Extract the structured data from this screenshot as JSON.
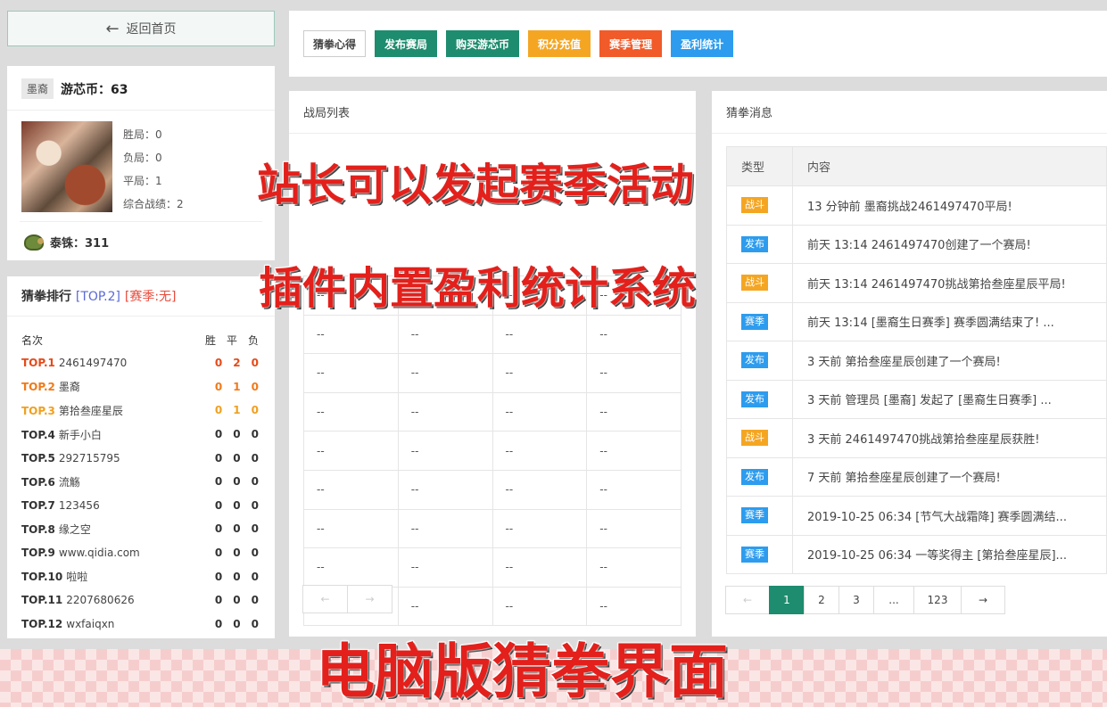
{
  "back_button": {
    "label": "返回首页"
  },
  "user": {
    "tag": "墨裔",
    "coin_label": "游芯币：63",
    "stats": [
      "胜局：0",
      "负局：0",
      "平局：1",
      "综合战绩：2"
    ],
    "pearl_label": "泰铢：311"
  },
  "ranking": {
    "title": "猜拳排行",
    "top_tag": "[TOP.2]",
    "season_tag": "[赛季:无]",
    "col_name": "名次",
    "col_win": "胜",
    "col_draw": "平",
    "col_lose": "负",
    "rows": [
      {
        "rank": "TOP.1",
        "name": "2461497470",
        "w": "0",
        "d": "2",
        "l": "0"
      },
      {
        "rank": "TOP.2",
        "name": "墨裔",
        "w": "0",
        "d": "1",
        "l": "0"
      },
      {
        "rank": "TOP.3",
        "name": "第拾叁座星辰",
        "w": "0",
        "d": "1",
        "l": "0"
      },
      {
        "rank": "TOP.4",
        "name": "新手小白",
        "w": "0",
        "d": "0",
        "l": "0"
      },
      {
        "rank": "TOP.5",
        "name": "292715795",
        "w": "0",
        "d": "0",
        "l": "0"
      },
      {
        "rank": "TOP.6",
        "name": "流觞",
        "w": "0",
        "d": "0",
        "l": "0"
      },
      {
        "rank": "TOP.7",
        "name": "123456",
        "w": "0",
        "d": "0",
        "l": "0"
      },
      {
        "rank": "TOP.8",
        "name": "缘之空",
        "w": "0",
        "d": "0",
        "l": "0"
      },
      {
        "rank": "TOP.9",
        "name": "www.qidia.com",
        "w": "0",
        "d": "0",
        "l": "0"
      },
      {
        "rank": "TOP.10",
        "name": "啦啦",
        "w": "0",
        "d": "0",
        "l": "0"
      },
      {
        "rank": "TOP.11",
        "name": "2207680626",
        "w": "0",
        "d": "0",
        "l": "0"
      },
      {
        "rank": "TOP.12",
        "name": "wxfaiqxn",
        "w": "0",
        "d": "0",
        "l": "0"
      }
    ]
  },
  "toolbar": {
    "buttons": [
      {
        "label": "猜拳心得",
        "color": "#ffffff",
        "style": "plain"
      },
      {
        "label": "发布赛局",
        "color": "#1e8c6e"
      },
      {
        "label": "购买游芯币",
        "color": "#1e8c6e"
      },
      {
        "label": "积分充值",
        "color": "#f4a623"
      },
      {
        "label": "赛季管理",
        "color": "#f15a29"
      },
      {
        "label": "盈利统计",
        "color": "#2d9cee"
      }
    ]
  },
  "battle": {
    "title": "战局列表",
    "placeholder": "--",
    "prev": "←",
    "next": "→"
  },
  "messages": {
    "title": "猜拳消息",
    "col_type": "类型",
    "col_content": "内容",
    "rows": [
      {
        "type": "战斗",
        "color": "#f4a623",
        "content": "13 分钟前 墨裔挑战2461497470平局!"
      },
      {
        "type": "发布",
        "color": "#2d9cee",
        "content": "前天 13:14 2461497470创建了一个赛局!"
      },
      {
        "type": "战斗",
        "color": "#f4a623",
        "content": "前天 13:14 2461497470挑战第拾叁座星辰平局!"
      },
      {
        "type": "赛季",
        "color": "#2d9cee",
        "content": "前天 13:14 [墨裔生日赛季] 赛季圆满结束了! ..."
      },
      {
        "type": "发布",
        "color": "#2d9cee",
        "content": "3 天前 第拾叁座星辰创建了一个赛局!"
      },
      {
        "type": "发布",
        "color": "#2d9cee",
        "content": "3 天前 管理员 [墨裔] 发起了 [墨裔生日赛季] ..."
      },
      {
        "type": "战斗",
        "color": "#f4a623",
        "content": "3 天前 2461497470挑战第拾叁座星辰获胜!"
      },
      {
        "type": "发布",
        "color": "#2d9cee",
        "content": "7 天前 第拾叁座星辰创建了一个赛局!"
      },
      {
        "type": "赛季",
        "color": "#2d9cee",
        "content": "2019-10-25 06:34 [节气大战霜降] 赛季圆满结..."
      },
      {
        "type": "赛季",
        "color": "#2d9cee",
        "content": "2019-10-25 06:34 一等奖得主 [第拾叁座星辰]..."
      }
    ],
    "pager": [
      "←",
      "1",
      "2",
      "3",
      "...",
      "123",
      "→"
    ],
    "active_page": "1"
  },
  "overlays": {
    "line1": "站长可以发起赛季活动",
    "line2": "插件内置盈利统计系统",
    "line3": "电脑版猜拳界面"
  }
}
